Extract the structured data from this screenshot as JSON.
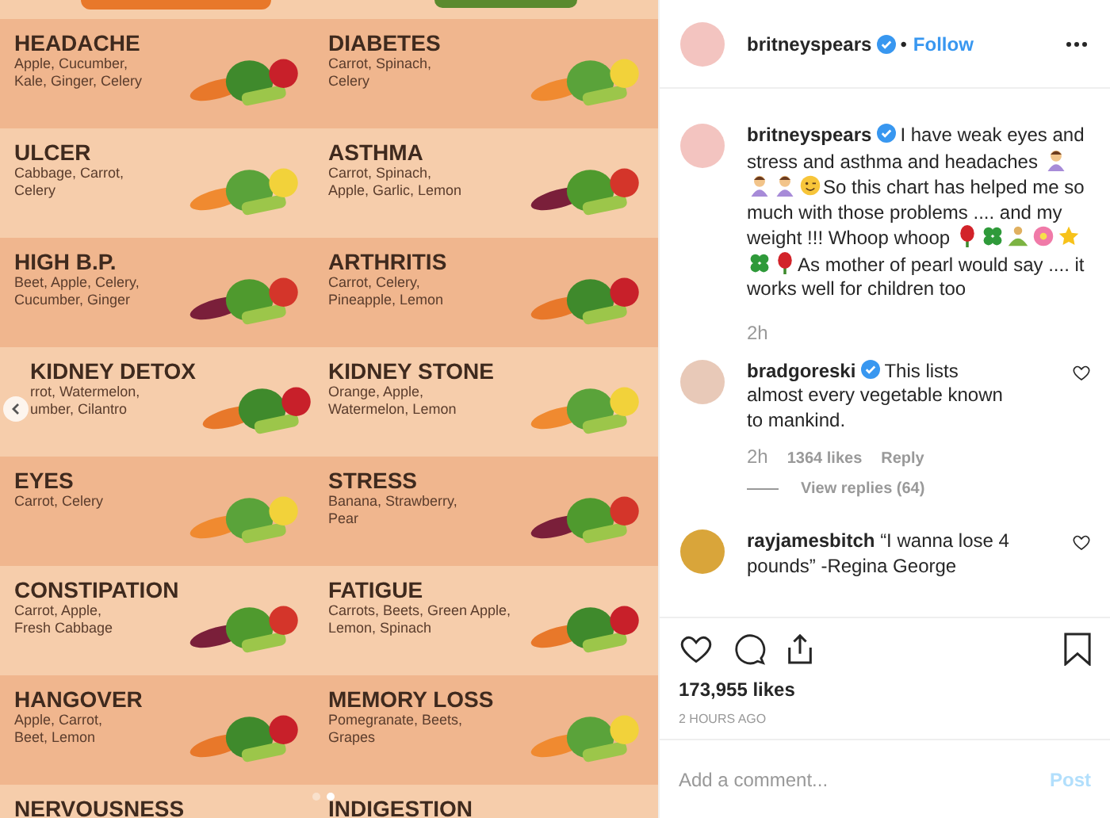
{
  "post_image": {
    "rows": [
      {
        "cells": [
          {
            "title": "HEADACHE",
            "ingredients": [
              "Apple, Cucumber,",
              "Kale, Ginger, Celery"
            ]
          },
          {
            "title": "DIABETES",
            "ingredients": [
              "Carrot, Spinach,",
              "Celery"
            ]
          }
        ]
      },
      {
        "cells": [
          {
            "title": "ULCER",
            "ingredients": [
              "Cabbage, Carrot,",
              "Celery"
            ]
          },
          {
            "title": "ASTHMA",
            "ingredients": [
              "Carrot, Spinach,",
              "Apple, Garlic, Lemon"
            ]
          }
        ]
      },
      {
        "cells": [
          {
            "title": "HIGH B.P.",
            "ingredients": [
              "Beet, Apple, Celery,",
              "Cucumber, Ginger"
            ]
          },
          {
            "title": "ARTHRITIS",
            "ingredients": [
              "Carrot, Celery,",
              "Pineapple, Lemon"
            ]
          }
        ]
      },
      {
        "cells": [
          {
            "title": "KIDNEY DETOX",
            "ingredients": [
              "rrot, Watermelon,",
              "umber, Cilantro"
            ]
          },
          {
            "title": "KIDNEY STONE",
            "ingredients": [
              "Orange, Apple,",
              "Watermelon, Lemon"
            ]
          }
        ]
      },
      {
        "cells": [
          {
            "title": "EYES",
            "ingredients": [
              "Carrot, Celery"
            ]
          },
          {
            "title": "STRESS",
            "ingredients": [
              "Banana, Strawberry,",
              "Pear"
            ]
          }
        ]
      },
      {
        "cells": [
          {
            "title": "CONSTIPATION",
            "ingredients": [
              "Carrot, Apple,",
              "Fresh Cabbage"
            ]
          },
          {
            "title": "FATIGUE",
            "ingredients": [
              "Carrots, Beets, Green Apple,",
              "Lemon, Spinach"
            ]
          }
        ]
      },
      {
        "cells": [
          {
            "title": "HANGOVER",
            "ingredients": [
              "Apple, Carrot,",
              "Beet, Lemon"
            ]
          },
          {
            "title": "MEMORY LOSS",
            "ingredients": [
              "Pomegranate, Beets,",
              "Grapes"
            ]
          }
        ]
      },
      {
        "cells": [
          {
            "title": "NERVOUSNESS"
          },
          {
            "title": "INDIGESTION"
          }
        ]
      }
    ],
    "carousel_dots": [
      {
        "selected": false
      },
      {
        "selected": true
      }
    ]
  },
  "header": {
    "username": "britneyspears",
    "separator": "•",
    "follow": "Follow"
  },
  "caption": {
    "username": "britneyspears",
    "segments": [
      {
        "kind": "text",
        "text": "I have weak eyes and stress and asthma and headaches"
      },
      {
        "kind": "person"
      },
      {
        "kind": "person"
      },
      {
        "kind": "person"
      },
      {
        "kind": "wink"
      },
      {
        "kind": "text",
        "text": "So this chart has helped me so much with those problems .... and my weight !!! Whoop whoop"
      },
      {
        "kind": "rose"
      },
      {
        "kind": "clover"
      },
      {
        "kind": "meditate"
      },
      {
        "kind": "flower"
      },
      {
        "kind": "star"
      },
      {
        "kind": "clover"
      },
      {
        "kind": "rose"
      },
      {
        "kind": "text",
        "text": "As mother of pearl would say .... it works well for children too"
      }
    ],
    "time": "2h"
  },
  "comments": [
    {
      "username": "bradgoreski",
      "verified": true,
      "text": "This lists almost every vegetable known to mankind.",
      "time": "2h",
      "likes": "1364 likes",
      "reply": "Reply",
      "view_replies": "View replies (64)"
    },
    {
      "username": "rayjamesbitch",
      "verified": false,
      "text": "“I wanna lose 4 pounds” -Regina George"
    }
  ],
  "likes": "173,955 likes",
  "timestamp": "2 HOURS AGO",
  "comment_box": {
    "placeholder": "Add a comment...",
    "post": "Post",
    "disabled": true
  }
}
